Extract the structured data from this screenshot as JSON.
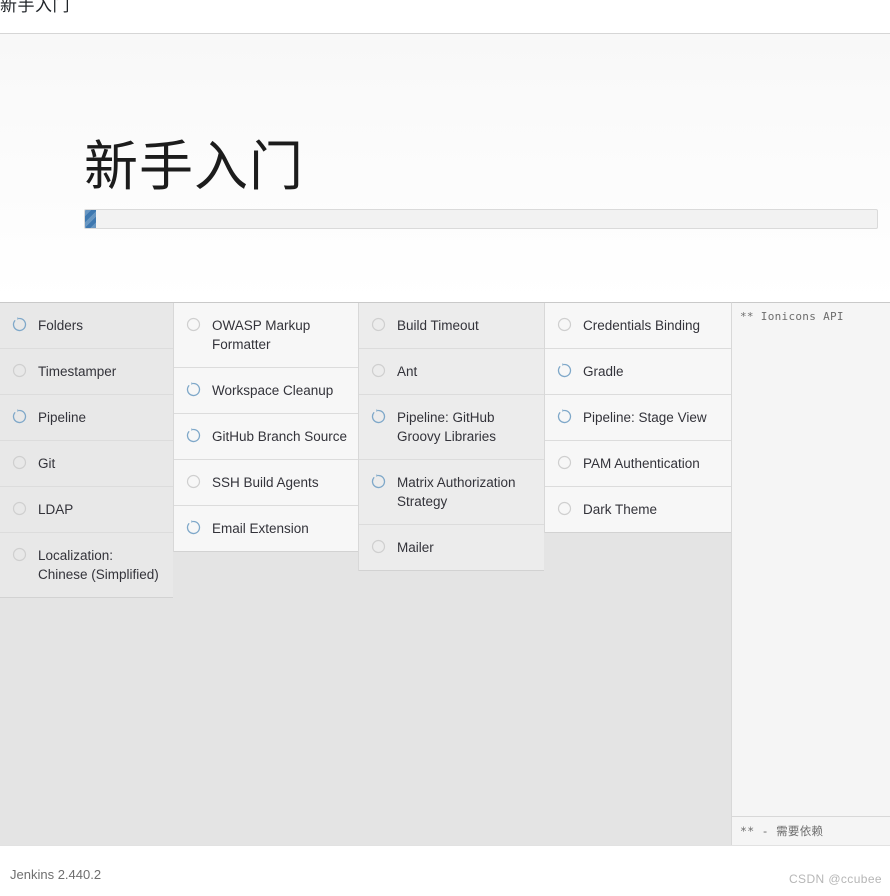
{
  "browser": {
    "tab_title": "新手入门"
  },
  "page": {
    "title": "新手入门",
    "progress_percent": 1
  },
  "colors": {
    "progress_fill": "#3e78b0",
    "spinner": "#7fa8c9",
    "pending_circle": "#cfcfcf",
    "page_background": "#e4e4e4",
    "panel_background": "#f5f5f5"
  },
  "plugin_columns": [
    {
      "column_name": "column-1",
      "items": [
        {
          "label": "Folders",
          "status": "installing",
          "icon": "spinner-icon"
        },
        {
          "label": "Timestamper",
          "status": "pending",
          "icon": "circle-icon"
        },
        {
          "label": "Pipeline",
          "status": "installing",
          "icon": "spinner-icon"
        },
        {
          "label": "Git",
          "status": "pending",
          "icon": "circle-icon"
        },
        {
          "label": "LDAP",
          "status": "pending",
          "icon": "circle-icon"
        },
        {
          "label": "Localization: Chinese (Simplified)",
          "status": "pending",
          "icon": "circle-icon"
        }
      ]
    },
    {
      "column_name": "column-2",
      "items": [
        {
          "label": "OWASP Markup Formatter",
          "status": "pending",
          "icon": "circle-icon"
        },
        {
          "label": "Workspace Cleanup",
          "status": "installing",
          "icon": "spinner-icon"
        },
        {
          "label": "GitHub Branch Source",
          "status": "installing",
          "icon": "spinner-icon"
        },
        {
          "label": "SSH Build Agents",
          "status": "pending",
          "icon": "circle-icon"
        },
        {
          "label": "Email Extension",
          "status": "installing",
          "icon": "spinner-icon"
        }
      ]
    },
    {
      "column_name": "column-3",
      "items": [
        {
          "label": "Build Timeout",
          "status": "pending",
          "icon": "circle-icon"
        },
        {
          "label": "Ant",
          "status": "pending",
          "icon": "circle-icon"
        },
        {
          "label": "Pipeline: GitHub Groovy Libraries",
          "status": "installing",
          "icon": "spinner-icon"
        },
        {
          "label": "Matrix Authorization Strategy",
          "status": "installing",
          "icon": "spinner-icon"
        },
        {
          "label": "Mailer",
          "status": "pending",
          "icon": "circle-icon"
        }
      ]
    },
    {
      "column_name": "column-4",
      "items": [
        {
          "label": "Credentials Binding",
          "status": "pending",
          "icon": "circle-icon"
        },
        {
          "label": "Gradle",
          "status": "installing",
          "icon": "spinner-icon"
        },
        {
          "label": "Pipeline: Stage View",
          "status": "installing",
          "icon": "spinner-icon"
        },
        {
          "label": "PAM Authentication",
          "status": "pending",
          "icon": "circle-icon"
        },
        {
          "label": "Dark Theme",
          "status": "pending",
          "icon": "circle-icon"
        }
      ]
    }
  ],
  "log_panel": {
    "lines": [
      "** Ionicons API"
    ],
    "legend": "** - 需要依赖"
  },
  "footer": {
    "version": "Jenkins 2.440.2",
    "watermark": "CSDN @ccubee"
  }
}
